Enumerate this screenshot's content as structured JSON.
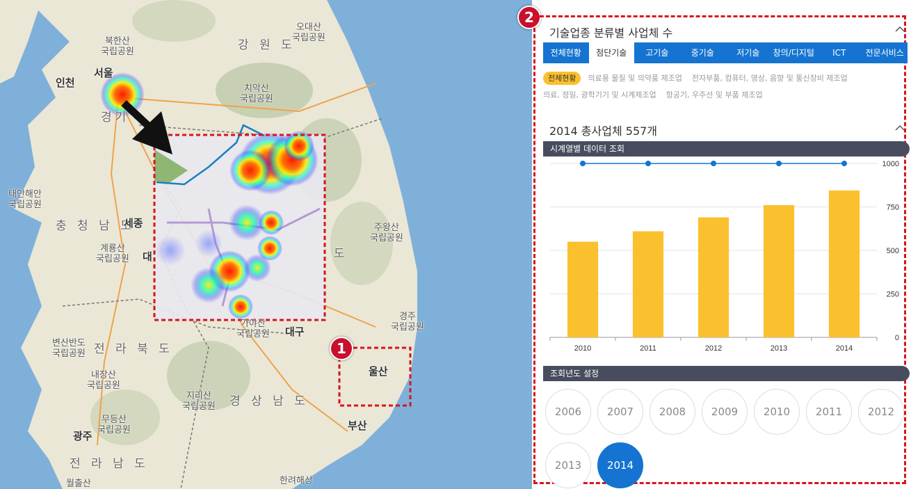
{
  "map": {
    "labels": {
      "bukhansan": "북한산\n국립공원",
      "seoul": "서울",
      "incheon": "인천",
      "gyeonggi": "경기",
      "odaesan": "오대산\n국립공원",
      "gangwon": "강 원 도",
      "chiaksan": "치악산\n국립공원",
      "taean": "태안해안\n국립공원",
      "chungnam": "충 청 남 도",
      "sejong": "세종",
      "gyeryongsan": "계룡산\n국립공원",
      "daejeon": "대",
      "juwangsan": "주왕산\n국립공원",
      "gyeongbuk_do": "도",
      "gayasan": "가야산\n국립공원",
      "daegu": "대구",
      "gyeongju": "경주\n국립공원",
      "byeonsanbando": "변산반도\n국립공원",
      "jeonbuk": "전 라 북 도",
      "naejangsan": "내장산\n국립공원",
      "jirisan": "지리산\n국립공원",
      "gyeongnam": "경 상 남 도",
      "ulsan": "울산",
      "mudeungsan": "무등산\n국립공원",
      "gwangju": "광주",
      "busan": "부산",
      "jeonnam": "전 라 남 도",
      "wolchulsan": "월출산",
      "hallyeo": "한려해상"
    },
    "badge1": "1",
    "badge2": "2",
    "heat_colors": {
      "hot": "#ff1a00",
      "warm": "#ffee00",
      "cool": "#00ffcc",
      "cold": "#3344ff"
    }
  },
  "panel": {
    "section_title": "기술업종 분류별 사업체 수",
    "tabs": [
      "전체현황",
      "첨단기술",
      "고기술",
      "중기술",
      "저기술",
      "창의/디지털",
      "ICT",
      "전문서비스"
    ],
    "active_tab_index": 1,
    "subcategories": [
      "전체현황",
      "의료용 물질 및 의약품 제조업",
      "전자부품, 컴퓨터, 영상, 음향 및 통신장비 제조업",
      "의료, 정밀, 광학기기 및 시계제조업",
      "항공기, 우주선 및 부품 제조업"
    ],
    "active_subcategory_index": 0,
    "summary_title": "2014 총사업체 557개",
    "timeseries_header": "시계열별 데이터 조회",
    "year_header": "조회년도 설정",
    "years": [
      "2006",
      "2007",
      "2008",
      "2009",
      "2010",
      "2011",
      "2012",
      "2013",
      "2014"
    ],
    "selected_year": "2014"
  },
  "colors": {
    "accent": "#1574d1",
    "bar": "#fbc02d",
    "header": "#474d5e",
    "dashed": "#d8141f"
  },
  "chart_data": {
    "type": "bar",
    "categories": [
      "2010",
      "2011",
      "2012",
      "2013",
      "2014"
    ],
    "values": [
      550,
      610,
      690,
      760,
      845
    ],
    "line_values": [
      1000,
      1000,
      1000,
      1000,
      1000
    ],
    "yticks": [
      0,
      250,
      500,
      750,
      1000
    ],
    "ylim": [
      0,
      1000
    ],
    "grid": true
  }
}
